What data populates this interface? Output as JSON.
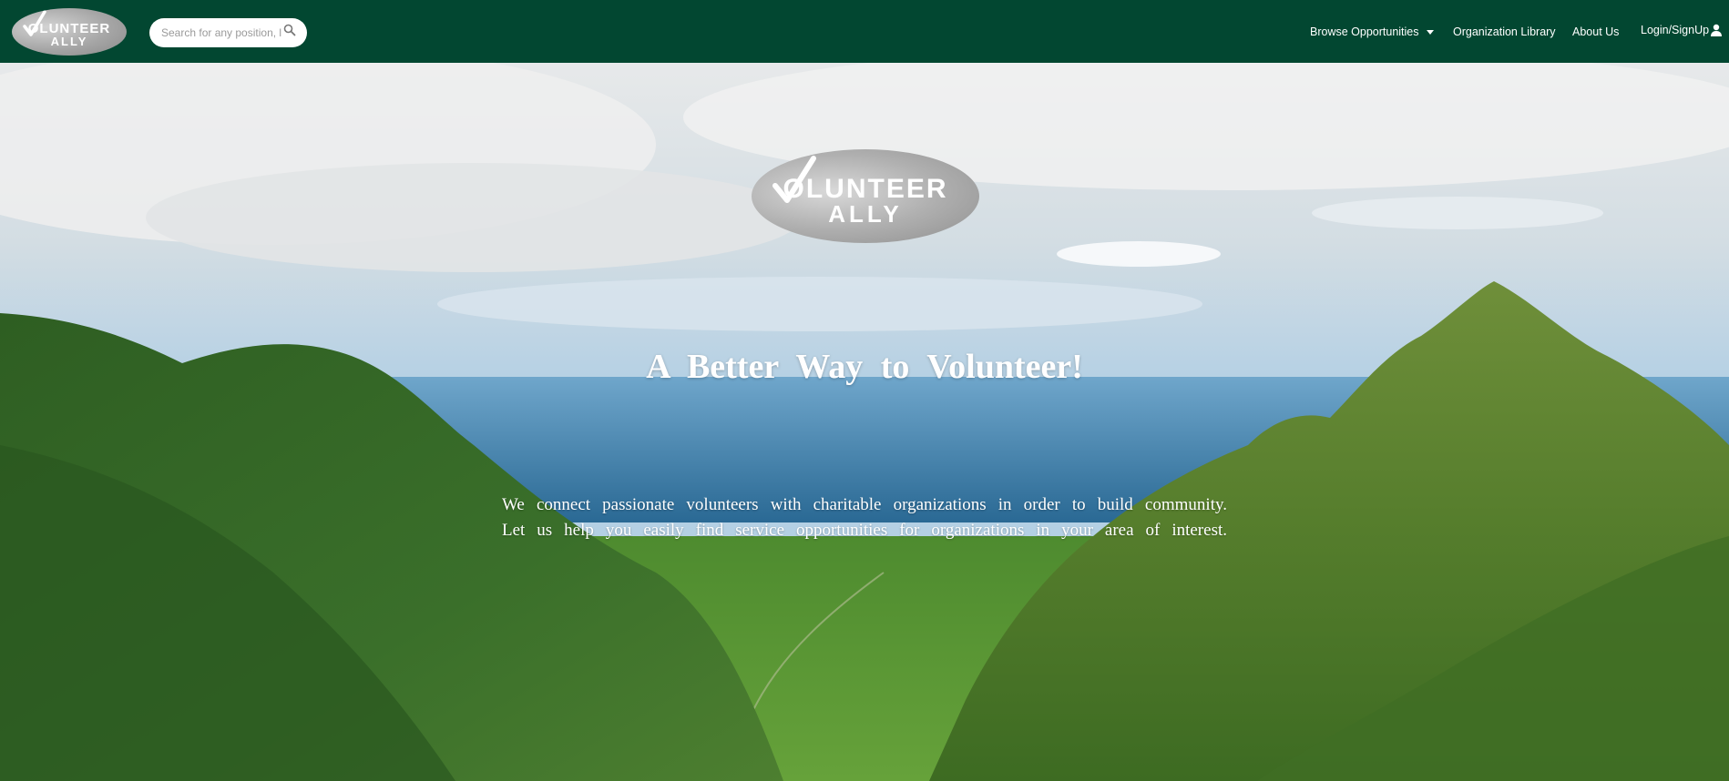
{
  "brand": {
    "logo_line1": "OLUNTEER",
    "logo_line2": "ALLY",
    "nav_bg_color": "#024731"
  },
  "search": {
    "placeholder": "Search for any position, location, or organization",
    "icon": "search-icon"
  },
  "nav": {
    "browse_label": "Browse Opportunities",
    "org_library_label": "Organization Library",
    "about_label": "About Us",
    "login_label": "Login/SignUp",
    "login_icon": "user-icon",
    "browse_icon": "caret-down-icon"
  },
  "hero": {
    "logo_line1": "OLUNTEER",
    "logo_line2": "ALLY",
    "title": "A Better Way to Volunteer!",
    "desc_line1": "We connect passionate volunteers with charitable organizations in order to build community.",
    "desc_line2": "Let us help you easily find service opportunities for organizations in your area of interest."
  }
}
